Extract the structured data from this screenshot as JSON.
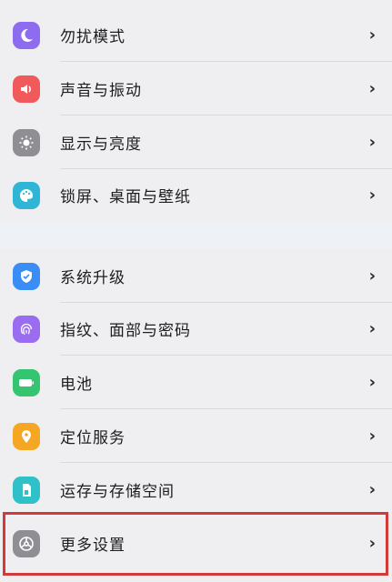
{
  "settings": {
    "rows": [
      {
        "label": "勿扰模式",
        "icon": "moon-icon",
        "color": "#8e6cf0"
      },
      {
        "label": "声音与振动",
        "icon": "speaker-icon",
        "color": "#f05a5a"
      },
      {
        "label": "显示与亮度",
        "icon": "sun-icon",
        "color": "#8e8e93"
      },
      {
        "label": "锁屏、桌面与壁纸",
        "icon": "palette-icon",
        "color": "#2fb6d6"
      },
      {
        "label": "系统升级",
        "icon": "shield-icon",
        "color": "#3a8df5"
      },
      {
        "label": "指纹、面部与密码",
        "icon": "fingerprint-icon",
        "color": "#9a6cf0"
      },
      {
        "label": "电池",
        "icon": "battery-icon",
        "color": "#35c46f"
      },
      {
        "label": "定位服务",
        "icon": "location-icon",
        "color": "#f5a623"
      },
      {
        "label": "运存与存储空间",
        "icon": "storage-icon",
        "color": "#2fc0c8"
      },
      {
        "label": "更多设置",
        "icon": "more-settings-icon",
        "color": "#8e8e93"
      }
    ],
    "chevron": "›"
  }
}
